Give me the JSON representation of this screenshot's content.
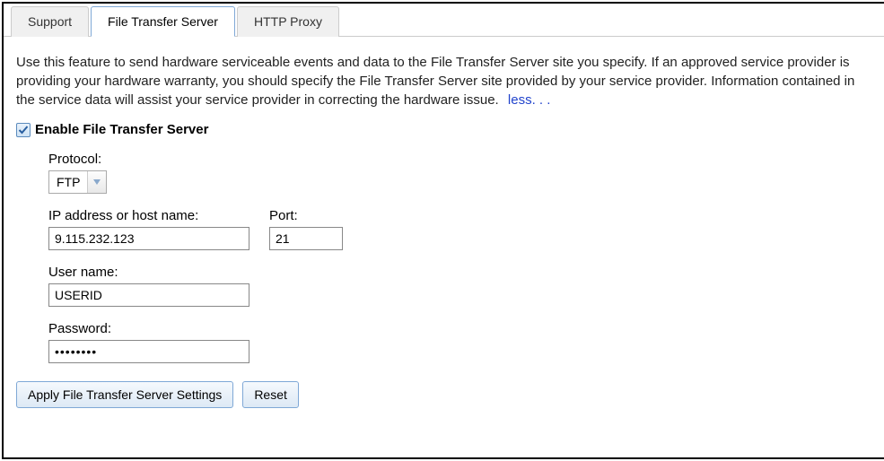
{
  "tabs": {
    "support": "Support",
    "file_transfer_server": "File Transfer Server",
    "http_proxy": "HTTP Proxy"
  },
  "description": "Use this feature to send hardware serviceable events and data to the File Transfer Server site you specify. If an approved service provider is providing your hardware warranty, you should specify the File Transfer Server site provided by your service provider. Information contained in the service data will assist your service provider in correcting the hardware issue.",
  "less_label": "less. . .",
  "enable_label": "Enable File Transfer Server",
  "enable_checked": true,
  "form": {
    "protocol_label": "Protocol:",
    "protocol_value": "FTP",
    "ip_label": "IP address or host name:",
    "ip_value": "9.115.232.123",
    "port_label": "Port:",
    "port_value": "21",
    "user_label": "User name:",
    "user_value": "USERID",
    "password_label": "Password:",
    "password_value": "••••••••"
  },
  "buttons": {
    "apply": "Apply File Transfer Server Settings",
    "reset": "Reset"
  }
}
